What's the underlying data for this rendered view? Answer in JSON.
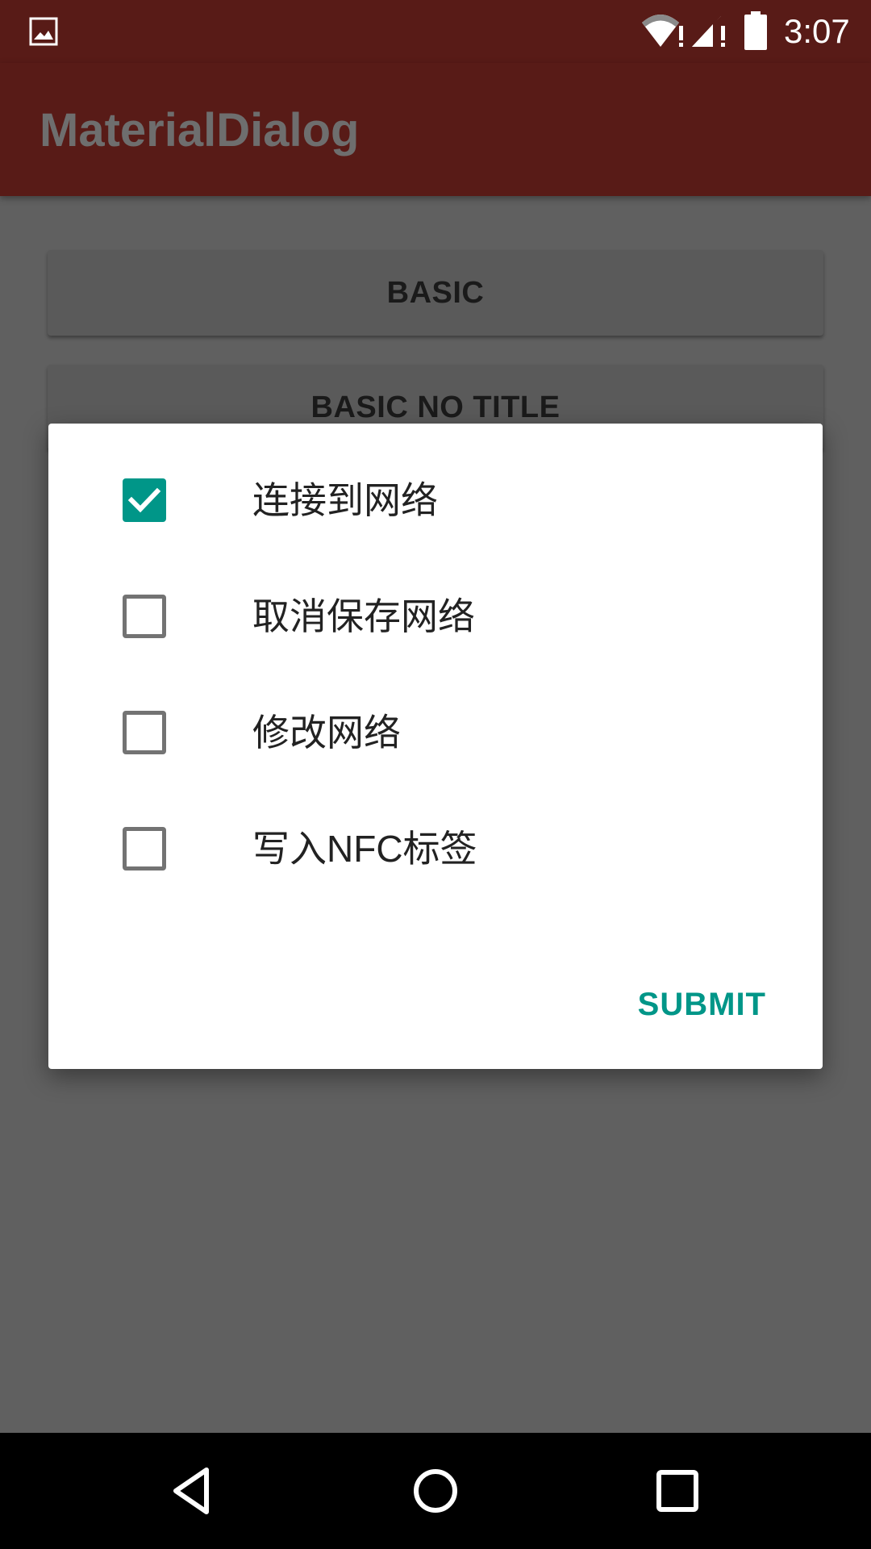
{
  "status_bar": {
    "time": "3:07",
    "icons": [
      "gallery-icon",
      "wifi-icon",
      "signal-icon",
      "battery-icon"
    ]
  },
  "app_bar": {
    "title": "MaterialDialog"
  },
  "background_buttons": [
    {
      "label": "BASIC"
    },
    {
      "label": "BASIC NO TITLE"
    }
  ],
  "dialog": {
    "options": [
      {
        "label": "连接到网络",
        "checked": true
      },
      {
        "label": "取消保存网络",
        "checked": false
      },
      {
        "label": "修改网络",
        "checked": false
      },
      {
        "label": "写入NFC标签",
        "checked": false
      }
    ],
    "submit_label": "SUBMIT"
  },
  "navigation_bar": {
    "icons": [
      "back-icon",
      "home-icon",
      "recents-icon"
    ]
  },
  "colors": {
    "primary_dark": "#581b17",
    "accent": "#009688",
    "scrim_background": "#606060"
  }
}
